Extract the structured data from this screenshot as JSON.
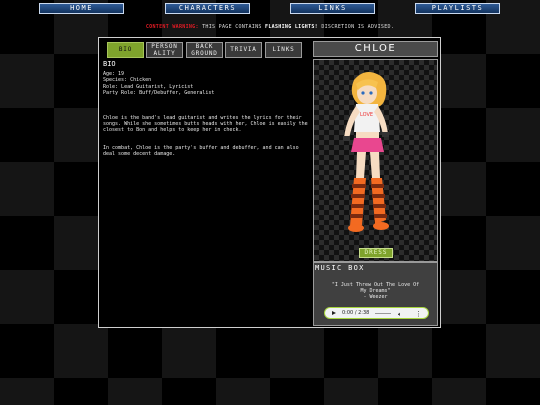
{
  "nav": {
    "items": [
      {
        "label": "HOME"
      },
      {
        "label": "CHARACTERS"
      },
      {
        "label": "LINKS"
      },
      {
        "label": "PLAYLISTS"
      }
    ]
  },
  "warning": {
    "prefix": "CONTENT WARNING:",
    "text_before": "THIS PAGE CONTAINS",
    "highlight": "FLASHING LIGHTS!",
    "text_after": "DISCRETION IS ADVISED."
  },
  "tabs": [
    {
      "label": "BIO"
    },
    {
      "label": "PERSON ALITY"
    },
    {
      "label": "BACK GROUND"
    },
    {
      "label": "TRIVIA"
    },
    {
      "label": "LINKS"
    }
  ],
  "bio": {
    "heading": "BIO",
    "stats": [
      "Age: 19",
      "Species: Chicken",
      "Role: Lead Guitarist, Lyricist",
      "Party Role: Buff/Debuffer, Generalist"
    ],
    "paragraph1": "Chloe is the band's lead guitarist and writes the lyrics for their songs. While she sometimes butts heads with her, Chloe is easily the closest to Bon and helps to keep her in check.",
    "paragraph2": "In combat, Chloe is the party's buffer and debuffer, and can also deal some decent damage."
  },
  "character": {
    "name": "CHLOE",
    "dress_label": "DRESS",
    "colors": {
      "hair": "#f3b53f",
      "shirt": "#f2f2f2",
      "skirt": "#e9478f",
      "sock_orange": "#f36a21",
      "sock_dark": "#7a2a10"
    }
  },
  "music": {
    "title": "MUSIC BOX",
    "song_line1": "\"I Just Threw Out The Love Of",
    "song_line2": "My Dreams\"",
    "artist": "- Weezer",
    "time": "0:00 / 2:38",
    "accent": "#a7d63e"
  }
}
